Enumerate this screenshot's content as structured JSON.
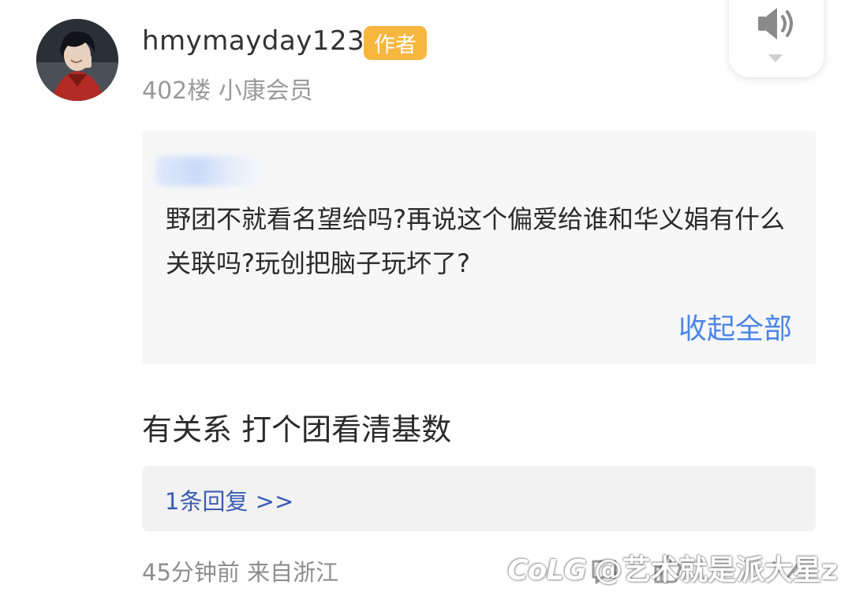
{
  "post": {
    "username": "hmymayday123",
    "author_badge": "作者",
    "floor_info": "402楼 小康会员",
    "quote": {
      "user": "",
      "text": "野团不就看名望给吗?再说这个偏爱给谁和华义娟有什么关联吗?玩创把脑子玩坏了?",
      "collapse_label": "收起全部"
    },
    "reply_text": "有关系 打个团看清基数",
    "subreply_link": "1条回复 >>",
    "meta": "45分钟前 来自浙江"
  },
  "watermark": {
    "logo": "CoLG",
    "text": "@艺术就是派大星z"
  },
  "colors": {
    "accent_blue": "#4a86e8",
    "badge_orange": "#f7b63e",
    "link_blue": "#3b5bb5"
  },
  "icons": {
    "sound": "speaker-icon",
    "reply": "comment-icon",
    "like": "thumb-up-icon",
    "more": "more-icon"
  }
}
